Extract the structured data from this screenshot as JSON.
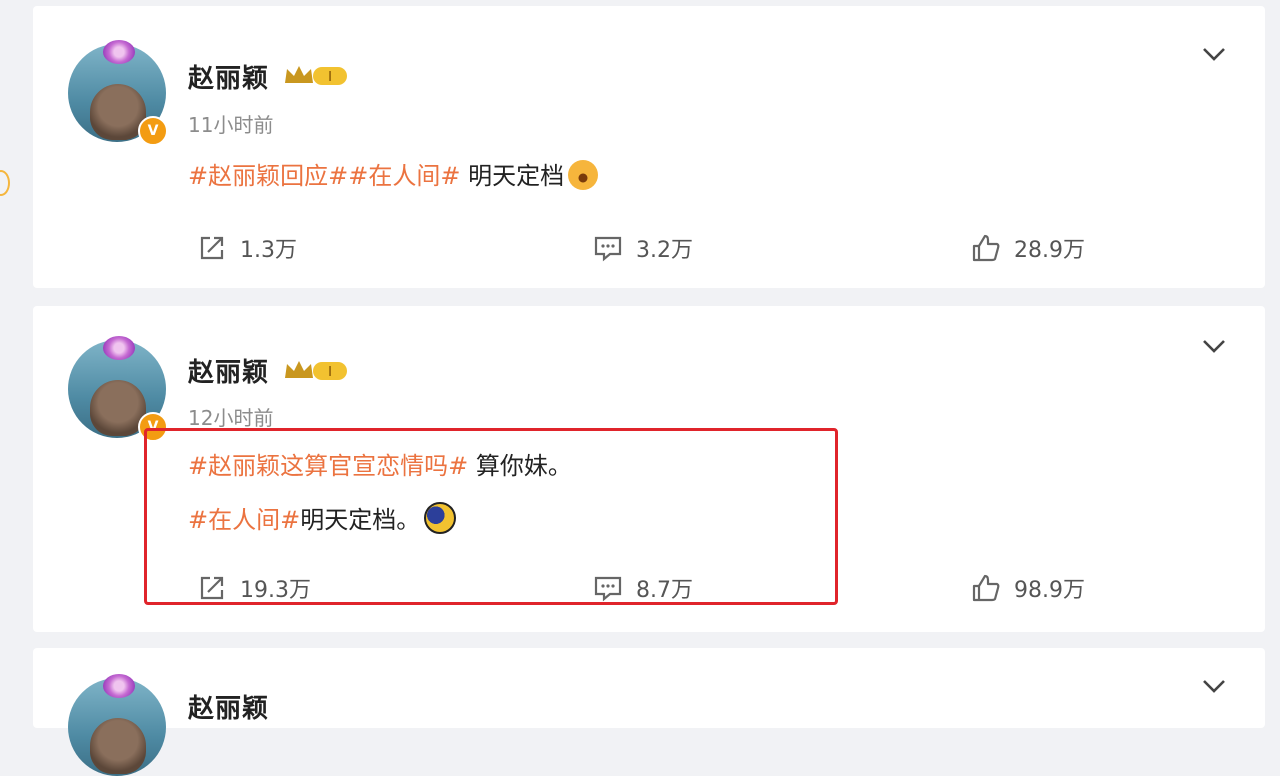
{
  "posts": [
    {
      "author": "赵丽颖",
      "time": "11小时前",
      "tag1": "#赵丽颖回应#",
      "tag2": "#在人间#",
      "text": " 明天定档",
      "repost": "1.3万",
      "comment": "3.2万",
      "like": "28.9万"
    },
    {
      "author": "赵丽颖",
      "time": "12小时前",
      "tag1": "#赵丽颖这算官宣恋情吗#",
      "text1": " 算你妹。",
      "tag2": "#在人间#",
      "text2": "明天定档。",
      "repost": "19.3万",
      "comment": "8.7万",
      "like": "98.9万"
    },
    {
      "author": "赵丽颖"
    }
  ],
  "crown_badge": "I",
  "colors": {
    "tag": "#eb7340",
    "highlight": "#e0242b",
    "verified": "#f39c12"
  }
}
